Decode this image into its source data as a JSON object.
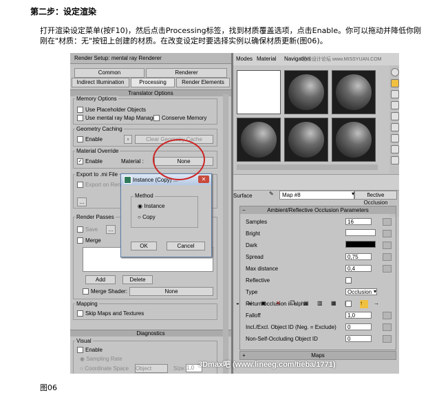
{
  "doc": {
    "step_heading": "第二步：设定渲染",
    "paragraph": "打开渲染设定菜单(按F10)，然后点击Processing标签，找到材质覆盖选项，点击Enable。你可以拖动并降低你刚刚在\"材质：无\"按钮上创建的材质。在改变设定时要选择实例以确保材质更新(图06)。",
    "caption": "图06"
  },
  "render_setup": {
    "title": "Render Setup: mental ray Renderer",
    "tabs": [
      "Common",
      "Renderer",
      "Indirect Illumination",
      "Processing",
      "Render Elements"
    ],
    "section_translator": "Translator Options",
    "memory_options": {
      "label": "Memory Options",
      "use_placeholder": "Use Placeholder Objects",
      "use_map_manager": "Use mental ray Map Manager",
      "conserve_memory": "Conserve Memory"
    },
    "geometry_caching": {
      "label": "Geometry Caching",
      "enable": "Enable",
      "clear_button": "Clear Geometry Cache"
    },
    "material_override": {
      "label": "Material Override",
      "enable": "Enable",
      "material_label": "Material :",
      "material_value": "None"
    },
    "export_mi": {
      "label": "Export to .mi File",
      "export_on_render": "Export on Render",
      "browse": "..."
    },
    "render_passes": {
      "label": "Render Passes",
      "save": "Save",
      "browse": "...",
      "merge": "Merge",
      "add": "Add",
      "delete": "Delete",
      "merge_shader": "Merge Shader:",
      "merge_shader_value": "None"
    },
    "mapping": {
      "label": "Mapping",
      "skip_maps": "Skip Maps and Textures"
    },
    "section_diagnostics": "Diagnostics",
    "visual": {
      "label": "Visual",
      "enable": "Enable",
      "sampling_rate": "Sampling Rate",
      "coordinate_space": "Coordinate Space",
      "object": "Object",
      "size": "Size:",
      "size_value": "1,0"
    }
  },
  "dialog": {
    "title": "Instance (Copy) ...",
    "close": "✕",
    "method_label": "Method",
    "option_instance": "Instance",
    "option_copy": "Copy",
    "ok": "OK",
    "cancel": "Cancel"
  },
  "material_editor": {
    "menu": [
      "Modes",
      "Material",
      "Navigation"
    ],
    "watermark_top": "思缘设计论坛 www.MISSYUAN.COM",
    "surface_label": "Surface",
    "map_name": "Map #8",
    "map_type": "flective Occlusion",
    "rollout_title": "Ambient/Reflective Occlusion Parameters",
    "params": [
      {
        "label": "Samples",
        "value": "16"
      },
      {
        "label": "Bright",
        "value": ""
      },
      {
        "label": "Dark",
        "value": ""
      },
      {
        "label": "Spread",
        "value": "0,75"
      },
      {
        "label": "Max distance",
        "value": "0,4"
      },
      {
        "label": "Reflective",
        "value": ""
      },
      {
        "label": "Type",
        "value": "Occlusion"
      },
      {
        "label": "Return occlusion in alpha",
        "value": ""
      },
      {
        "label": "Falloff",
        "value": "1,0"
      },
      {
        "label": "Incl./Excl. Object ID (Neg. = Exclude)",
        "value": "0"
      },
      {
        "label": "Non-Self-Occluding Object ID",
        "value": "0"
      }
    ],
    "maps_rollout": "Maps",
    "colors": {
      "bright": "#ffffff",
      "dark": "#000000"
    }
  },
  "watermark_bottom": "3Dmax吧 (www.lineeg.com/tieba/1771)",
  "colors": {
    "highlight_circle": "#cc2424"
  }
}
